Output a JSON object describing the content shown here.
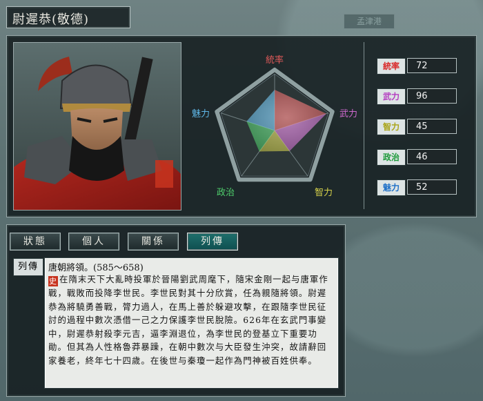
{
  "header": {
    "title": "尉遲恭(敬德)",
    "map_label": "孟津港"
  },
  "portrait": {
    "icon": "warlord-portrait"
  },
  "radar": {
    "labels": {
      "top": "統率",
      "right": "武力",
      "bottom_right": "智力",
      "bottom_left": "政治",
      "left": "魅力"
    },
    "values": [
      72,
      96,
      45,
      46,
      52
    ],
    "max": 100,
    "colors": {
      "top": "#e05a5a",
      "right": "#d06ad0",
      "bottom_right": "#d6d24a",
      "bottom_left": "#4fcf6c",
      "left": "#5fb8e8"
    }
  },
  "stats": [
    {
      "label": "統率",
      "value": "72",
      "color": "#d92a2a"
    },
    {
      "label": "武力",
      "value": "96",
      "color": "#b43cc0"
    },
    {
      "label": "智力",
      "value": "45",
      "color": "#a9a417"
    },
    {
      "label": "政治",
      "value": "46",
      "color": "#1c9a3a"
    },
    {
      "label": "魅力",
      "value": "52",
      "color": "#1d6fc7"
    }
  ],
  "tabs": [
    {
      "label": "狀態",
      "active": false
    },
    {
      "label": "個人",
      "active": false
    },
    {
      "label": "關係",
      "active": false
    },
    {
      "label": "列傳",
      "active": true
    }
  ],
  "bio": {
    "label": "列傳",
    "heading": "唐朝將領。(585～658)",
    "mark": "史",
    "text": "在隋末天下大亂時投軍於晉陽劉武周麾下，隨宋金剛一起与唐軍作戰，戰敗而投降李世民。李世民對其十分欣賞，任為親隨將領。尉遲恭為將驍勇善戰，膂力過人，在馬上善於躲避攻擊，在跟隨李世民征討的過程中數次憑借一己之力保護李世民脫險。626年在玄武門事變中，尉遲恭射殺李元吉，逼李淵退位，為李世民的登基立下重要功勛。但其為人性格魯莽暴躁，在朝中數次与大臣發生沖突，故請辭回家養老，終年七十四歲。在後世与秦瓊一起作為門神被百姓供奉。"
  }
}
